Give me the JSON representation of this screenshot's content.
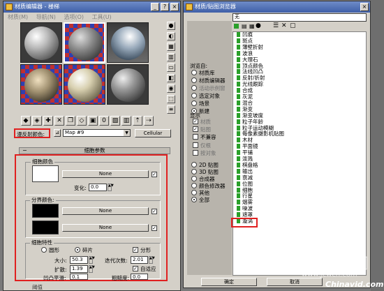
{
  "material_editor": {
    "title": "材质编辑器 - 楼梯",
    "menu": [
      "材质(M)",
      "导航(N)",
      "选项(O)",
      "工具(U)"
    ],
    "side_tool_icons": [
      "sphere-icon",
      "backlight-icon",
      "background-icon",
      "tiling-icon",
      "video-check-icon",
      "preview-icon",
      "options-icon",
      "select-by-material-icon",
      "material-navigator-icon"
    ],
    "horizontal_tool_icons": [
      "get-material-icon",
      "put-to-scene-icon",
      "assign-material-icon",
      "reset-icon",
      "copy-material-icon",
      "make-unique-icon",
      "put-to-library-icon",
      "material-effects-channel-icon",
      "show-map-icon",
      "show-end-result-icon",
      "go-to-parent-icon",
      "go-forward-icon"
    ],
    "map_slot_label": "漫反射颜色:",
    "map_name": "Map #9",
    "map_type": "Cellular",
    "rollout_title": "细胞参数",
    "cell_color": {
      "group": "细胞颜色",
      "map_button": "None",
      "variation_label": "变化:",
      "variation_value": "0.0",
      "swatch": "#ffffff"
    },
    "division_colors": {
      "group": "分界颜色:",
      "map_button_1": "None",
      "map_button_2": "None",
      "swatch": "#000000"
    },
    "cell_char": {
      "group": "细胞特性",
      "radio_circular": "圆形",
      "radio_chips": "碎片",
      "fractal_label": "分形",
      "size_label": "大小:",
      "size_value": "50.3",
      "spread_label": "扩散:",
      "spread_value": "1.39",
      "bump_smoothing_label": "凹凸平滑:",
      "bump_smoothing_value": "0.1",
      "iterations_label": "迭代次数:",
      "iterations_value": "2.01",
      "adaptive_label": "自适应",
      "roughness_label": "粗糙度:",
      "roughness_value": "0.0"
    },
    "thresholds_label": "阈值"
  },
  "browser": {
    "title": "材质/贴图浏览器",
    "name_field": "无",
    "browse_from_label": "浏览自:",
    "browse_from": [
      "材质库",
      "材质编辑器",
      "活动示例窗",
      "选定对象",
      "场景",
      "新建"
    ],
    "show_label": "显示",
    "show_opts": [
      "材质",
      "贴图",
      "不兼容"
    ],
    "root_only": "仅根",
    "by_object": "按对象",
    "category_opts": [
      "2D 贴图",
      "3D 贴图",
      "合成器",
      "颜色修改器",
      "其他",
      "全部"
    ],
    "map_list": [
      "凹痕",
      "斑点",
      "薄壁折射",
      "波浪",
      "大理石",
      "顶点颜色",
      "法线凹凸",
      "反射/折射",
      "光线跟踪",
      "合成",
      "灰泥",
      "混合",
      "渐变",
      "渐变坡度",
      "粒子年龄",
      "粒子运动模糊",
      "每像素摄影机贴图",
      "木材",
      "平面镜",
      "平铺",
      "泼溅",
      "棋盘格",
      "输出",
      "衰减",
      "位图",
      "细胞",
      "行星",
      "烟雾",
      "噪波",
      "遮罩",
      "漩涡"
    ],
    "selected_item": "细胞",
    "ok_button": "确定",
    "cancel_button": "取消"
  },
  "watermark": {
    "text": "中国教程网",
    "url": "www.jcwcn.com",
    "brand": "Chinavid.com"
  },
  "colors": {
    "highlight_red": "#e02020",
    "title_blue": "#3e5fa8",
    "map_green": "#2aa02a"
  }
}
